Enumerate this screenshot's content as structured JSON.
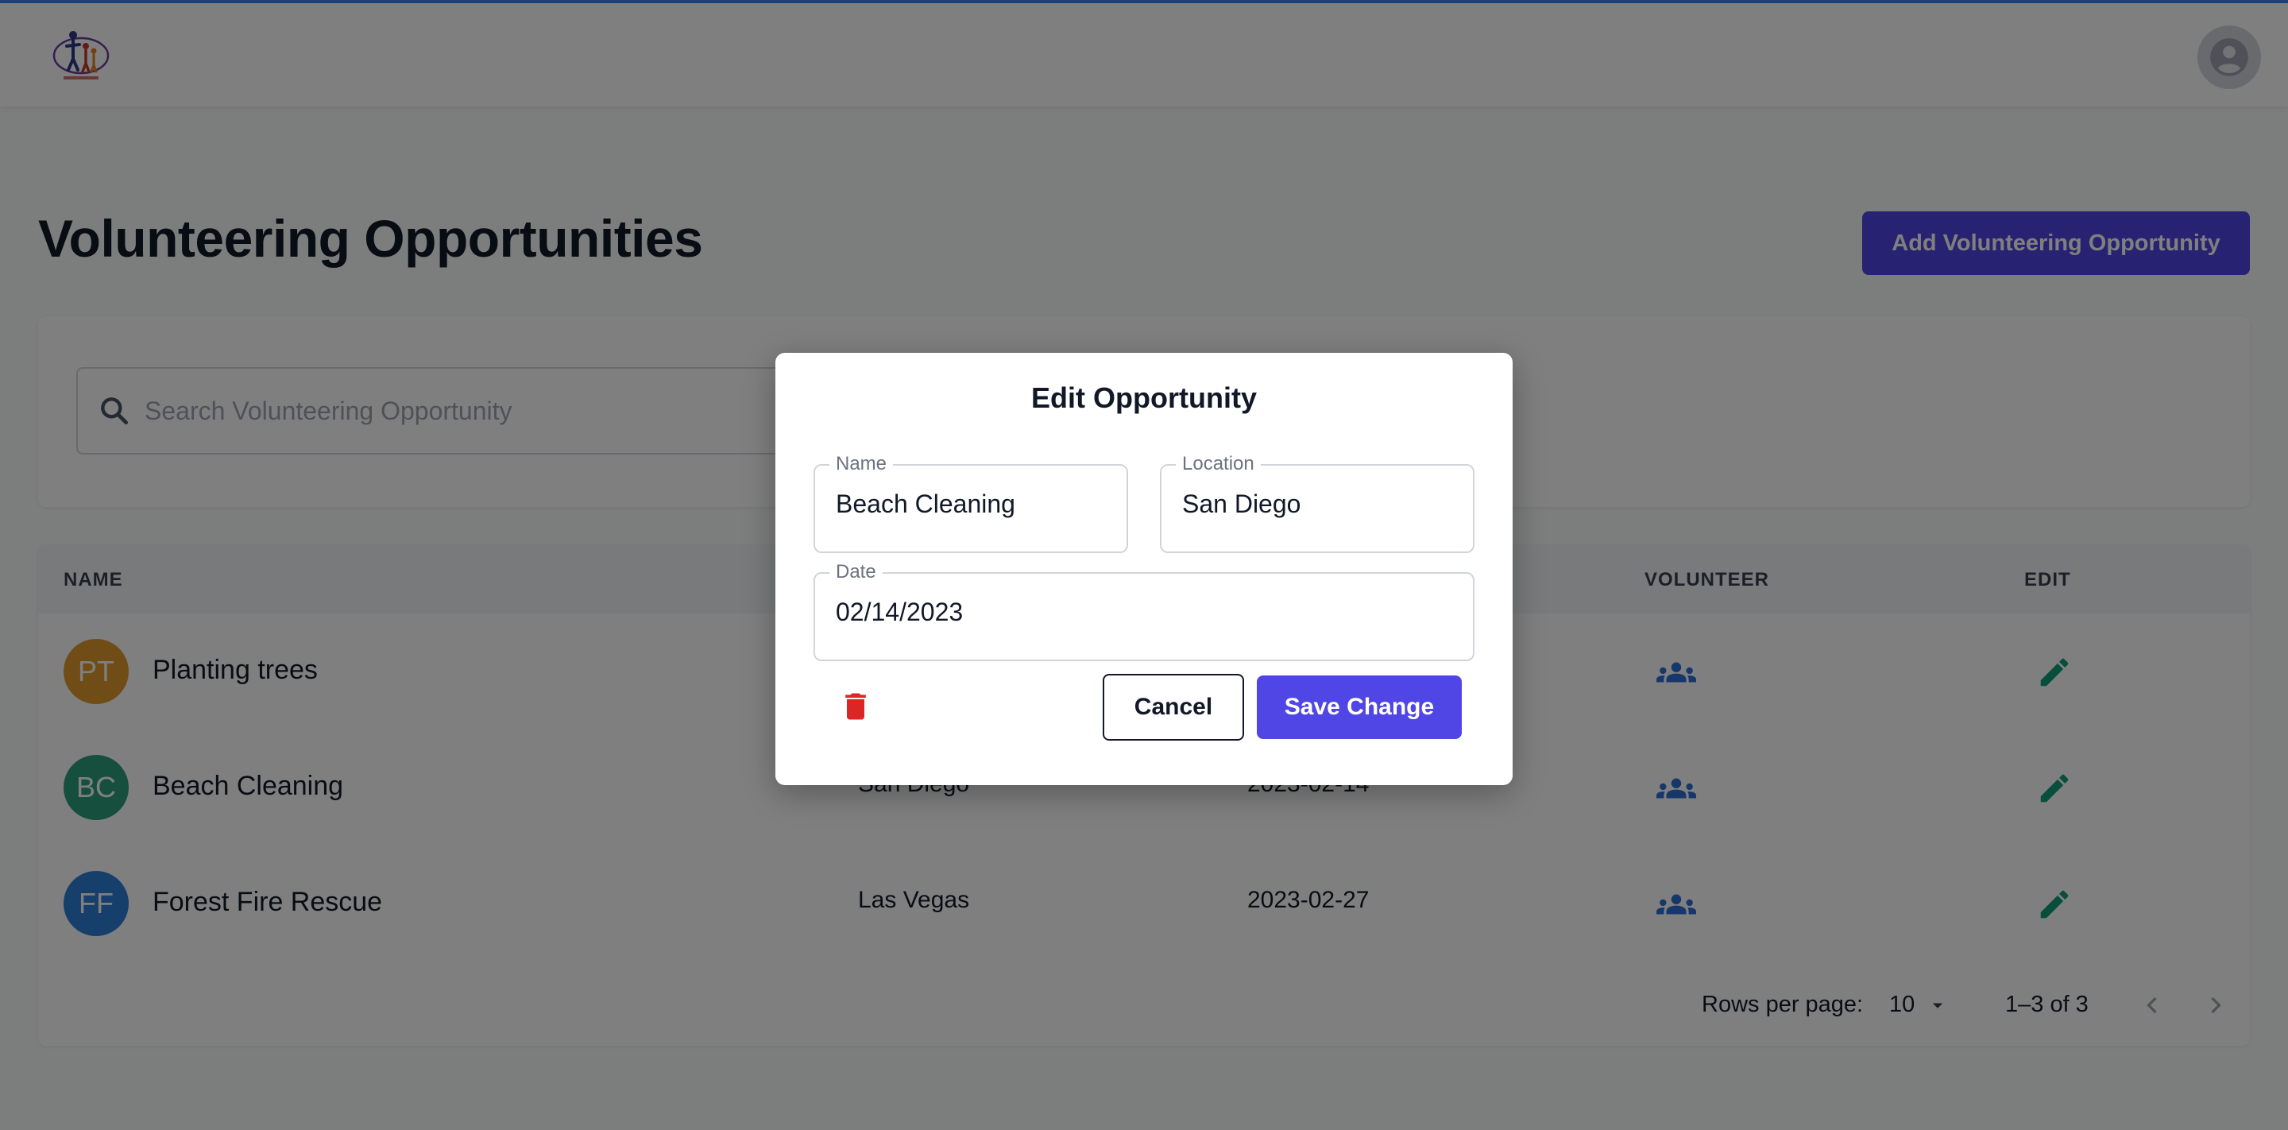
{
  "header": {
    "logo_icon": "volunteer-family-logo",
    "profile_icon": "account-circle-icon"
  },
  "page": {
    "title": "Volunteering Opportunities",
    "add_button_label": "Add Volunteering Opportunity"
  },
  "search": {
    "placeholder": "Search Volunteering Opportunity",
    "value": ""
  },
  "table": {
    "columns": {
      "name": "NAME",
      "volunteer": "VOLUNTEER",
      "edit": "EDIT"
    },
    "rows": [
      {
        "initials": "PT",
        "name": "Planting trees",
        "location": "",
        "date": "",
        "avatar_color": "#e09a2e"
      },
      {
        "initials": "BC",
        "name": "Beach Cleaning",
        "location": "San Diego",
        "date": "2023-02-14",
        "avatar_color": "#2f9e7e"
      },
      {
        "initials": "FF",
        "name": "Forest Fire Rescue",
        "location": "Las Vegas",
        "date": "2023-02-27",
        "avatar_color": "#2f7fd6"
      }
    ],
    "volunteer_icon": "group-icon",
    "edit_icon": "pencil-icon"
  },
  "pagination": {
    "rows_per_page_label": "Rows per page:",
    "rows_per_page": "10",
    "range": "1–3 of 3"
  },
  "modal": {
    "title": "Edit Opportunity",
    "name_label": "Name",
    "name_value": "Beach Cleaning",
    "location_label": "Location",
    "location_value": "San Diego",
    "date_label": "Date",
    "date_value": "02/14/2023",
    "cancel_label": "Cancel",
    "save_label": "Save Change"
  },
  "colors": {
    "accent": "#4f46e5",
    "delete": "#dc2626",
    "edit_icon": "#0f9d7a",
    "volunteer_icon": "#2f6fd6",
    "topline": "#3b82f6"
  }
}
